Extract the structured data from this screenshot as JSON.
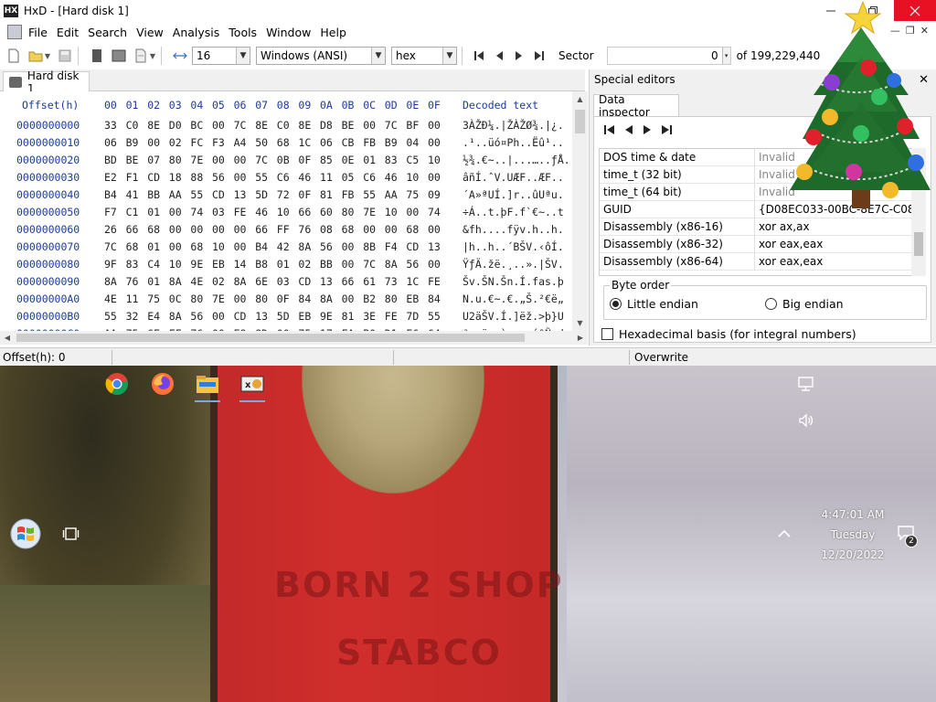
{
  "window": {
    "title": "HxD - [Hard disk 1]",
    "app_icon_text": "HX"
  },
  "menu": [
    "File",
    "Edit",
    "Search",
    "View",
    "Analysis",
    "Tools",
    "Window",
    "Help"
  ],
  "toolbar": {
    "bytes_per_row": "16",
    "charset": "Windows (ANSI)",
    "offset_base": "hex",
    "sector_label": "Sector",
    "sector_value": "0",
    "sector_total": "of 199,229,440"
  },
  "tab": {
    "label": "Hard disk 1"
  },
  "hex": {
    "offset_header": "Offset(h)",
    "columns": [
      "00",
      "01",
      "02",
      "03",
      "04",
      "05",
      "06",
      "07",
      "08",
      "09",
      "0A",
      "0B",
      "0C",
      "0D",
      "0E",
      "0F"
    ],
    "decoded_header": "Decoded text",
    "rows": [
      {
        "off": "0000000000",
        "bytes": [
          "33",
          "C0",
          "8E",
          "D0",
          "BC",
          "00",
          "7C",
          "8E",
          "C0",
          "8E",
          "D8",
          "BE",
          "00",
          "7C",
          "BF",
          "00"
        ],
        "text": "3ÀŽÐ¼.|ŽÀŽØ¾.|¿."
      },
      {
        "off": "0000000010",
        "bytes": [
          "06",
          "B9",
          "00",
          "02",
          "FC",
          "F3",
          "A4",
          "50",
          "68",
          "1C",
          "06",
          "CB",
          "FB",
          "B9",
          "04",
          "00"
        ],
        "text": ".¹..üó¤Ph..Ëû¹.."
      },
      {
        "off": "0000000020",
        "bytes": [
          "BD",
          "BE",
          "07",
          "80",
          "7E",
          "00",
          "00",
          "7C",
          "0B",
          "0F",
          "85",
          "0E",
          "01",
          "83",
          "C5",
          "10"
        ],
        "text": "½¾.€~..|...…..ƒÅ."
      },
      {
        "off": "0000000030",
        "bytes": [
          "E2",
          "F1",
          "CD",
          "18",
          "88",
          "56",
          "00",
          "55",
          "C6",
          "46",
          "11",
          "05",
          "C6",
          "46",
          "10",
          "00"
        ],
        "text": "âñÍ.ˆV.UÆF..ÆF.."
      },
      {
        "off": "0000000040",
        "bytes": [
          "B4",
          "41",
          "BB",
          "AA",
          "55",
          "CD",
          "13",
          "5D",
          "72",
          "0F",
          "81",
          "FB",
          "55",
          "AA",
          "75",
          "09"
        ],
        "text": "´A»ªUÍ.]r..ûUªu."
      },
      {
        "off": "0000000050",
        "bytes": [
          "F7",
          "C1",
          "01",
          "00",
          "74",
          "03",
          "FE",
          "46",
          "10",
          "66",
          "60",
          "80",
          "7E",
          "10",
          "00",
          "74"
        ],
        "text": "÷Á..t.þF.f`€~..t"
      },
      {
        "off": "0000000060",
        "bytes": [
          "26",
          "66",
          "68",
          "00",
          "00",
          "00",
          "00",
          "66",
          "FF",
          "76",
          "08",
          "68",
          "00",
          "00",
          "68",
          "00"
        ],
        "text": "&fh....fÿv.h..h."
      },
      {
        "off": "0000000070",
        "bytes": [
          "7C",
          "68",
          "01",
          "00",
          "68",
          "10",
          "00",
          "B4",
          "42",
          "8A",
          "56",
          "00",
          "8B",
          "F4",
          "CD",
          "13"
        ],
        "text": "|h..h..´BŠV.‹ôÍ."
      },
      {
        "off": "0000000080",
        "bytes": [
          "9F",
          "83",
          "C4",
          "10",
          "9E",
          "EB",
          "14",
          "B8",
          "01",
          "02",
          "BB",
          "00",
          "7C",
          "8A",
          "56",
          "00"
        ],
        "text": "ŸƒÄ.žë.¸..».|ŠV."
      },
      {
        "off": "0000000090",
        "bytes": [
          "8A",
          "76",
          "01",
          "8A",
          "4E",
          "02",
          "8A",
          "6E",
          "03",
          "CD",
          "13",
          "66",
          "61",
          "73",
          "1C",
          "FE"
        ],
        "text": "Šv.ŠN.Šn.Í.fas.þ"
      },
      {
        "off": "00000000A0",
        "bytes": [
          "4E",
          "11",
          "75",
          "0C",
          "80",
          "7E",
          "00",
          "80",
          "0F",
          "84",
          "8A",
          "00",
          "B2",
          "80",
          "EB",
          "84"
        ],
        "text": "N.u.€~.€.„Š.²€ë„"
      },
      {
        "off": "00000000B0",
        "bytes": [
          "55",
          "32",
          "E4",
          "8A",
          "56",
          "00",
          "CD",
          "13",
          "5D",
          "EB",
          "9E",
          "81",
          "3E",
          "FE",
          "7D",
          "55"
        ],
        "text": "U2äŠV.Í.]ëž.>þ}U"
      },
      {
        "off": "00000000C0",
        "bytes": [
          "AA",
          "75",
          "6E",
          "FF",
          "76",
          "00",
          "E8",
          "8D",
          "00",
          "75",
          "17",
          "FA",
          "B0",
          "D1",
          "E6",
          "64"
        ],
        "text": "ªunÿv.è..u.ú°Ñæd"
      },
      {
        "off": "00000000D0",
        "bytes": [
          "E8",
          "83",
          "00",
          "B0",
          "DF",
          "E6",
          "60",
          "E8",
          "7C",
          "00",
          "B0",
          "FF",
          "E6",
          "64",
          "E8",
          "75"
        ],
        "text": "èƒ.°ßæ`è|.°ÿædèu"
      },
      {
        "off": "00000000E0",
        "bytes": [
          "00",
          "FB",
          "B8",
          "00",
          "BB",
          "CD",
          "1A",
          "66",
          "23",
          "C0",
          "75",
          "3B",
          "66",
          "81",
          "FB",
          "54"
        ],
        "text": ".û¸.»Í.f#Àu;f.ûT"
      }
    ]
  },
  "special_editors": {
    "title": "Special editors",
    "tab": "Data inspector",
    "rows": [
      {
        "key": "DOS time & date",
        "value": "Invalid",
        "invalid": true
      },
      {
        "key": "time_t (32 bit)",
        "value": "Invalid",
        "invalid": true
      },
      {
        "key": "time_t (64 bit)",
        "value": "Invalid",
        "invalid": true
      },
      {
        "key": "GUID",
        "value": "{D08EC033-00BC-8E7C-C08E-D8",
        "invalid": false
      },
      {
        "key": "Disassembly (x86-16)",
        "value": "xor ax,ax",
        "invalid": false
      },
      {
        "key": "Disassembly (x86-32)",
        "value": "xor eax,eax",
        "invalid": false
      },
      {
        "key": "Disassembly (x86-64)",
        "value": "xor eax,eax",
        "invalid": false
      }
    ],
    "byte_order_label": "Byte order",
    "little_endian": "Little endian",
    "big_endian": "Big endian",
    "hex_basis": "Hexadecimal basis (for integral numbers)"
  },
  "status": {
    "offset": "Offset(h): 0",
    "mode": "Overwrite"
  },
  "desktop": {
    "clock_time": "4:47:01 AM",
    "clock_day": "Tuesday",
    "clock_date": "12/20/2022",
    "notification_count": "2",
    "shirt_text_1": "BORN 2 SHOP",
    "shirt_text_2": "STABCO"
  }
}
